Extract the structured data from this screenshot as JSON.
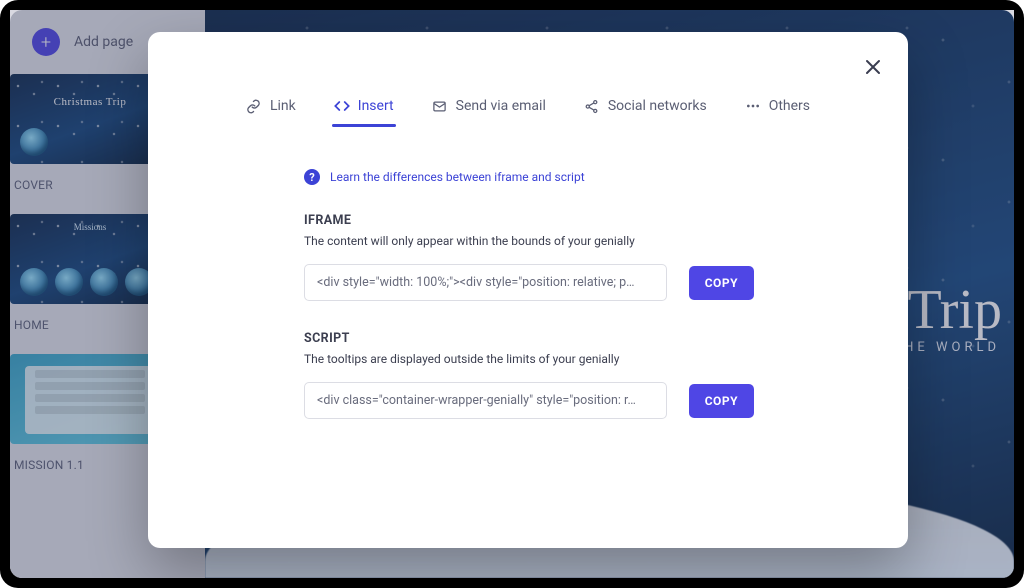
{
  "toolbar": {
    "add_page_label": "Add page"
  },
  "thumbnails": [
    {
      "label": "COVER",
      "title": "Christmas Trip"
    },
    {
      "label": "HOME",
      "missions": "Missions"
    },
    {
      "label": "MISSION 1.1"
    }
  ],
  "canvas": {
    "title": "Trip",
    "subtitle": "THE WORLD"
  },
  "modal": {
    "close_aria": "Close",
    "tabs": {
      "link": "Link",
      "insert": "Insert",
      "email": "Send via email",
      "social": "Social networks",
      "others": "Others"
    },
    "help_link": "Learn the differences between iframe and script",
    "iframe": {
      "title": "IFRAME",
      "subtitle": "The content will only appear within the bounds of your genially",
      "code": "<div style=\"width: 100%;\"><div style=\"position: relative; p…",
      "copy": "COPY"
    },
    "script": {
      "title": "SCRIPT",
      "subtitle": "The tooltips are displayed outside the limits of your genially",
      "code": "<div class=\"container-wrapper-genially\" style=\"position: r…",
      "copy": "COPY"
    }
  }
}
